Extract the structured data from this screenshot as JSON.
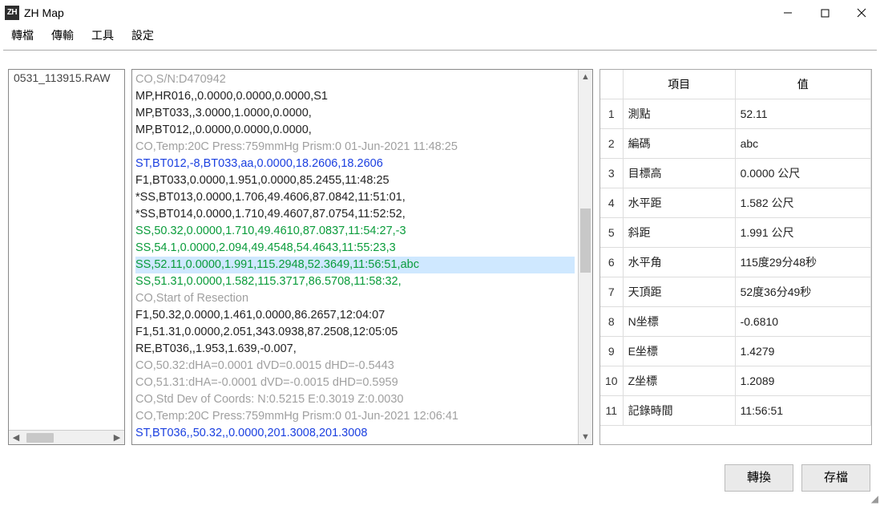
{
  "window": {
    "title": "ZH Map",
    "app_icon_text": "ZH"
  },
  "menu": {
    "items": [
      "轉檔",
      "傳輸",
      "工具",
      "設定"
    ]
  },
  "file_list": {
    "items": [
      "0531_113915.RAW"
    ]
  },
  "raw_lines": [
    {
      "text": "CO,S/N:D470942",
      "cls": "c-gray"
    },
    {
      "text": "MP,HR016,,0.0000,0.0000,0.0000,S1",
      "cls": "c-black"
    },
    {
      "text": "MP,BT033,,3.0000,1.0000,0.0000,",
      "cls": "c-black"
    },
    {
      "text": "MP,BT012,,0.0000,0.0000,0.0000,",
      "cls": "c-black"
    },
    {
      "text": "CO,Temp:20C Press:759mmHg Prism:0 01-Jun-2021 11:48:25",
      "cls": "c-gray"
    },
    {
      "text": "ST,BT012,-8,BT033,aa,0.0000,18.2606,18.2606",
      "cls": "c-blue"
    },
    {
      "text": "F1,BT033,0.0000,1.951,0.0000,85.2455,11:48:25",
      "cls": "c-black"
    },
    {
      "text": "*SS,BT013,0.0000,1.706,49.4606,87.0842,11:51:01,",
      "cls": "c-black"
    },
    {
      "text": "*SS,BT014,0.0000,1.710,49.4607,87.0754,11:52:52,",
      "cls": "c-black"
    },
    {
      "text": "SS,50.32,0.0000,1.710,49.4610,87.0837,11:54:27,-3",
      "cls": "c-green"
    },
    {
      "text": "SS,54.1,0.0000,2.094,49.4548,54.4643,11:55:23,3",
      "cls": "c-green"
    },
    {
      "text": "SS,52.11,0.0000,1.991,115.2948,52.3649,11:56:51,abc",
      "cls": "c-green",
      "selected": true
    },
    {
      "text": "SS,51.31,0.0000,1.582,115.3717,86.5708,11:58:32,",
      "cls": "c-green"
    },
    {
      "text": "CO,Start of Resection",
      "cls": "c-gray"
    },
    {
      "text": "F1,50.32,0.0000,1.461,0.0000,86.2657,12:04:07",
      "cls": "c-black"
    },
    {
      "text": "F1,51.31,0.0000,2.051,343.0938,87.2508,12:05:05",
      "cls": "c-black"
    },
    {
      "text": "RE,BT036,,1.953,1.639,-0.007,",
      "cls": "c-black"
    },
    {
      "text": "CO,50.32:dHA=0.0001 dVD=0.0015 dHD=-0.5443",
      "cls": "c-gray"
    },
    {
      "text": "CO,51.31:dHA=-0.0001 dVD=-0.0015 dHD=0.5959",
      "cls": "c-gray"
    },
    {
      "text": "CO,Std Dev of Coords: N:0.5215 E:0.3019 Z:0.0030",
      "cls": "c-gray"
    },
    {
      "text": "CO,Temp:20C Press:759mmHg Prism:0 01-Jun-2021 12:06:41",
      "cls": "c-gray"
    },
    {
      "text": "ST,BT036,,50.32,,0.0000,201.3008,201.3008",
      "cls": "c-blue"
    }
  ],
  "details": {
    "headers": {
      "item": "項目",
      "value": "值"
    },
    "rows": [
      {
        "idx": "1",
        "key": "測點",
        "val": "52.11"
      },
      {
        "idx": "2",
        "key": "編碼",
        "val": "abc"
      },
      {
        "idx": "3",
        "key": "目標高",
        "val": "0.0000 公尺"
      },
      {
        "idx": "4",
        "key": "水平距",
        "val": "1.582 公尺"
      },
      {
        "idx": "5",
        "key": "斜距",
        "val": "1.991 公尺"
      },
      {
        "idx": "6",
        "key": "水平角",
        "val": "115度29分48秒"
      },
      {
        "idx": "7",
        "key": "天頂距",
        "val": "52度36分49秒"
      },
      {
        "idx": "8",
        "key": "N坐標",
        "val": "-0.6810"
      },
      {
        "idx": "9",
        "key": "E坐標",
        "val": "1.4279"
      },
      {
        "idx": "10",
        "key": "Z坐標",
        "val": "1.2089"
      },
      {
        "idx": "11",
        "key": "記錄時間",
        "val": "11:56:51"
      }
    ]
  },
  "buttons": {
    "convert": "轉換",
    "save": "存檔"
  }
}
